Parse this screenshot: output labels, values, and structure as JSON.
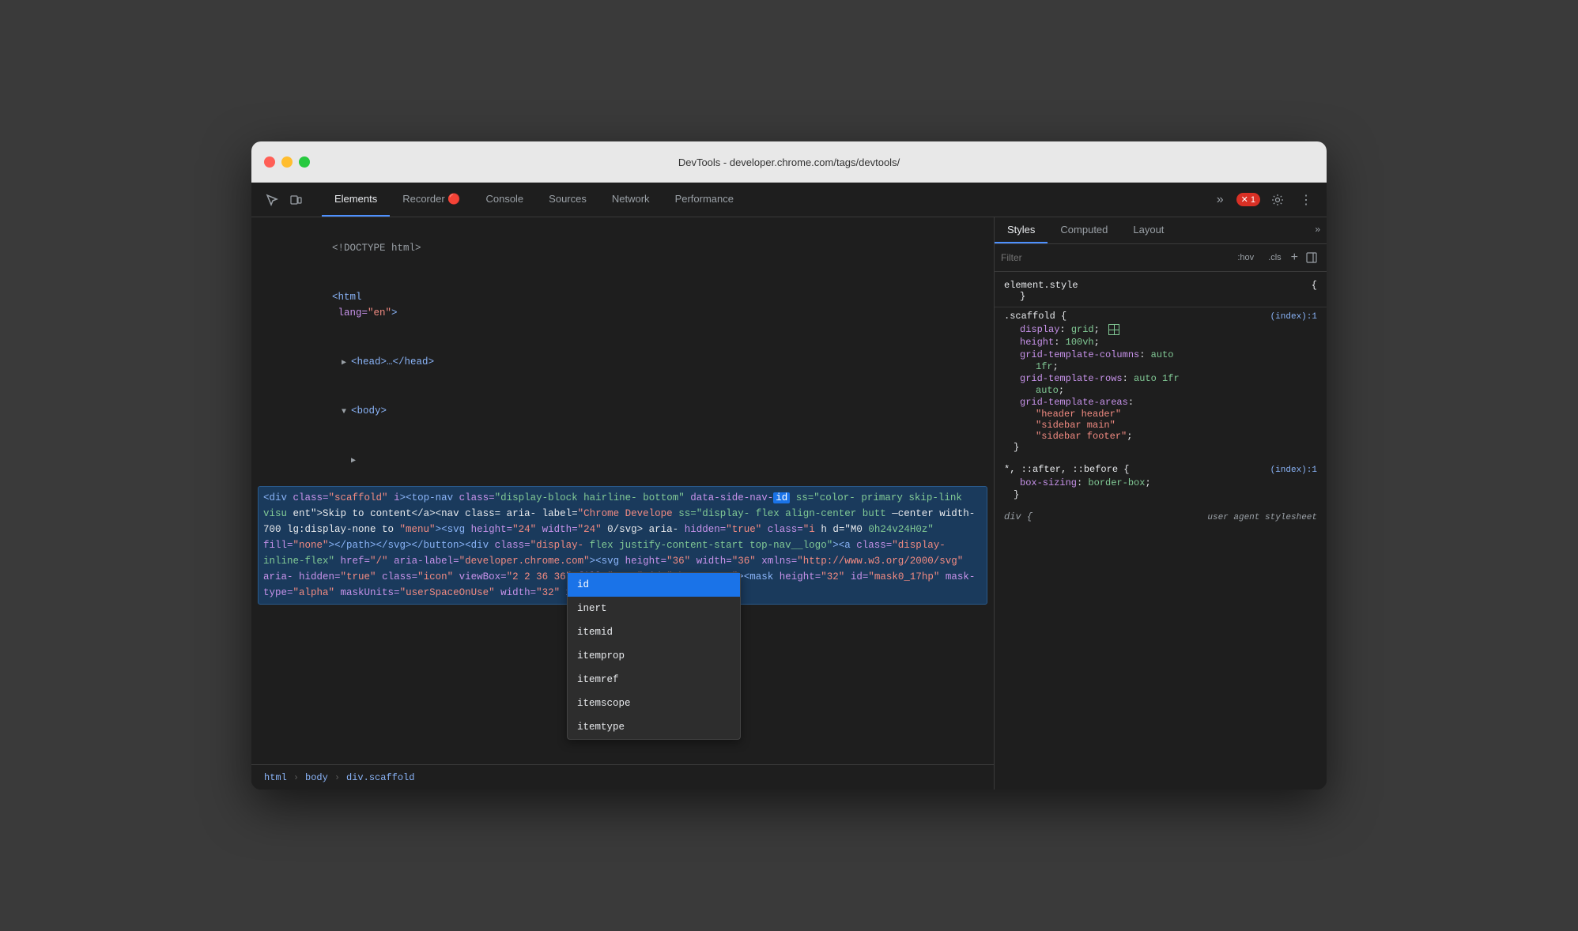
{
  "titlebar": {
    "title": "DevTools - developer.chrome.com/tags/devtools/"
  },
  "toolbar": {
    "tabs": [
      {
        "label": "Elements",
        "active": true
      },
      {
        "label": "Recorder 🔴",
        "active": false
      },
      {
        "label": "Console",
        "active": false
      },
      {
        "label": "Sources",
        "active": false
      },
      {
        "label": "Network",
        "active": false
      },
      {
        "label": "Performance",
        "active": false
      }
    ],
    "more_label": "»",
    "error_count": "1",
    "error_icon": "✕"
  },
  "elements_panel": {
    "html_tree": {
      "line1": "<!DOCTYPE html>",
      "line2": "<html lang=\"en\">",
      "line3": "▶ <head>…</head>",
      "line4": "▼ <body>",
      "line5": "  ▶"
    }
  },
  "selected_element": {
    "text": "<div class=\"scaffold\" id=<top-nav class=\"display-block hairline-bottom\" data-side-nav-id=                ss=\"color-primary skip-link visu                ent\">Skip to content</a><nav class=               aria-label=\"Chrome Develope              ss=\"display-flex align-center butt             —center width-700 lg:display-none to            height=\"24\" width=\"24\"            0/svg> aria-hidden=\"true\" class=\"i           0h24v24H0z\" fill=\"none\"></path></svg></button><div class=\"display-flex justify-content-start top-nav__logo\"><a class=\"display-inline-flex\" href=\"/\" aria-label=\"developer.chrome.com\"><svg height=\"36\" width=\"36\" xmlns=\"http://www.w3.org/2000/svg\" aria-hidden=\"true\" class=\"icon\" viewBox=\"2 2 36 36\" fill=\"none\" id=\"chromeLogo\"><mask height=\"32\" id=\"mask0_17hp\" mask-type=\"alpha\" maskUnits=\"userSpaceOnUse\" width=\"32\" x=\"4\" y=\"4\">"
  },
  "autocomplete": {
    "items": [
      {
        "label": "id",
        "selected": true
      },
      {
        "label": "inert",
        "selected": false
      },
      {
        "label": "itemid",
        "selected": false
      },
      {
        "label": "itemprop",
        "selected": false
      },
      {
        "label": "itemref",
        "selected": false
      },
      {
        "label": "itemscope",
        "selected": false
      },
      {
        "label": "itemtype",
        "selected": false
      }
    ]
  },
  "breadcrumb": {
    "items": [
      "html",
      "body",
      "div.scaffold"
    ]
  },
  "styles_panel": {
    "tabs": [
      {
        "label": "Styles",
        "active": true
      },
      {
        "label": "Computed",
        "active": false
      },
      {
        "label": "Layout",
        "active": false
      }
    ],
    "more_label": "»",
    "filter_placeholder": "Filter",
    "filter_hov": ":hov",
    "filter_cls": ".cls",
    "element_style": {
      "selector": "element.style",
      "open": "{",
      "close": "}"
    },
    "rules": [
      {
        "selector": ".scaffold",
        "source": "(index):1",
        "properties": [
          {
            "name": "display",
            "value": "grid",
            "has_icon": true
          },
          {
            "name": "height",
            "value": "100vh"
          },
          {
            "name": "grid-template-columns",
            "value": "auto 1fr"
          },
          {
            "name": "grid-template-rows",
            "value": "auto 1fr auto"
          },
          {
            "name": "grid-template-areas",
            "value": "\"header header\" \"sidebar main\" \"sidebar footer\""
          }
        ]
      },
      {
        "selector": "*, ::after, ::before",
        "source": "(index):1",
        "properties": [
          {
            "name": "box-sizing",
            "value": "border-box"
          }
        ]
      },
      {
        "selector": "div",
        "source": "user agent stylesheet",
        "properties": []
      }
    ]
  }
}
